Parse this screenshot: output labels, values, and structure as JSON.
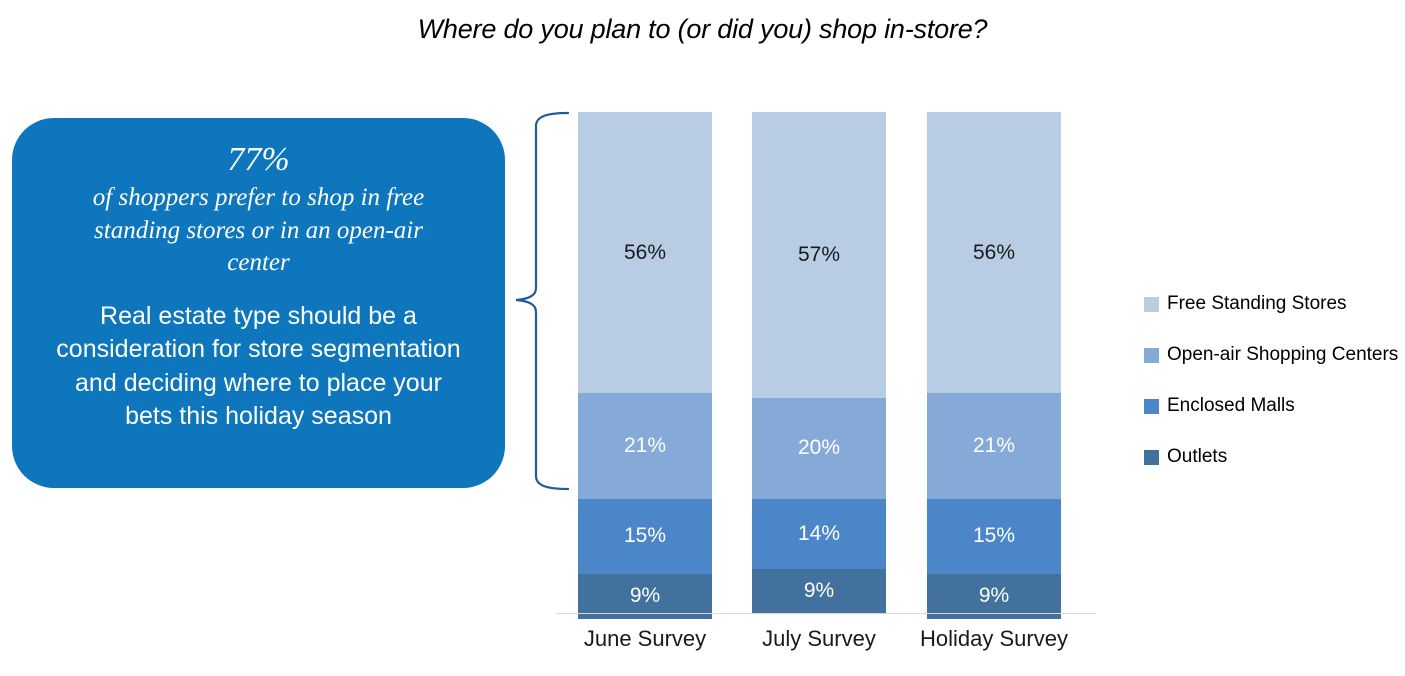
{
  "chart_data": {
    "type": "bar",
    "subtype": "stacked-column-100",
    "title": "Where do you plan to (or did you) shop in-store?",
    "xlabel": "",
    "ylabel": "",
    "ylim": [
      0,
      100
    ],
    "grid": false,
    "legend_position": "right",
    "categories": [
      "June Survey",
      "July Survey",
      "Holiday Survey"
    ],
    "series": [
      {
        "name": "Free Standing Stores",
        "color": "#b8cce4",
        "label_color": "#1a1a1a",
        "values": [
          56,
          57,
          56
        ],
        "labels": [
          "56%",
          "57%",
          "56%"
        ]
      },
      {
        "name": "Open-air Shopping Centers",
        "color": "#85aad8",
        "label_color": "#ffffff",
        "values": [
          21,
          20,
          21
        ],
        "labels": [
          "21%",
          "20%",
          "21%"
        ]
      },
      {
        "name": "Enclosed Malls",
        "color": "#4a86c8",
        "label_color": "#ffffff",
        "values": [
          15,
          14,
          15
        ],
        "labels": [
          "15%",
          "14%",
          "15%"
        ]
      },
      {
        "name": "Outlets",
        "color": "#41719c",
        "label_color": "#ffffff",
        "values": [
          9,
          9,
          9
        ],
        "labels": [
          "9%",
          "9%",
          "9%"
        ]
      }
    ]
  },
  "header": {
    "title": "Where do you plan to (or did you) shop in-store?"
  },
  "callout": {
    "background_color": "#0E76BC",
    "text_color": "#ffffff",
    "stat": "77%",
    "serif_lines": [
      "of shoppers prefer to shop in free",
      "standing stores or in an open-air",
      "center"
    ],
    "body_lines": [
      "Real estate type should be a",
      "consideration for store segmentation",
      "and deciding where to place your",
      "bets this holiday season"
    ]
  },
  "brace": {
    "color": "#1F5C99",
    "covers_series": [
      "Free Standing Stores",
      "Open-air Shopping Centers"
    ],
    "covers_total": "77%"
  },
  "legend": {
    "items": [
      {
        "label": "Free Standing Stores",
        "color": "#b8cce4"
      },
      {
        "label": "Open-air Shopping Centers",
        "color": "#85aad8"
      },
      {
        "label": "Enclosed Malls",
        "color": "#4a86c8"
      },
      {
        "label": "Outlets",
        "color": "#41719c"
      }
    ]
  },
  "axis": {
    "line_color": "#d9d9d9"
  }
}
